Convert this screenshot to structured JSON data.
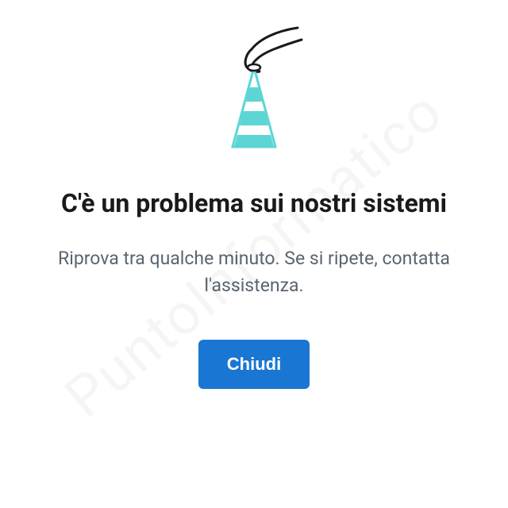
{
  "error": {
    "title": "C'è un problema sui nostri sistemi",
    "subtitle": "Riprova tra qualche minuto. Se si ripete, contatta l'assistenza.",
    "close_label": "Chiudi"
  },
  "watermark": "PuntoInformatico"
}
